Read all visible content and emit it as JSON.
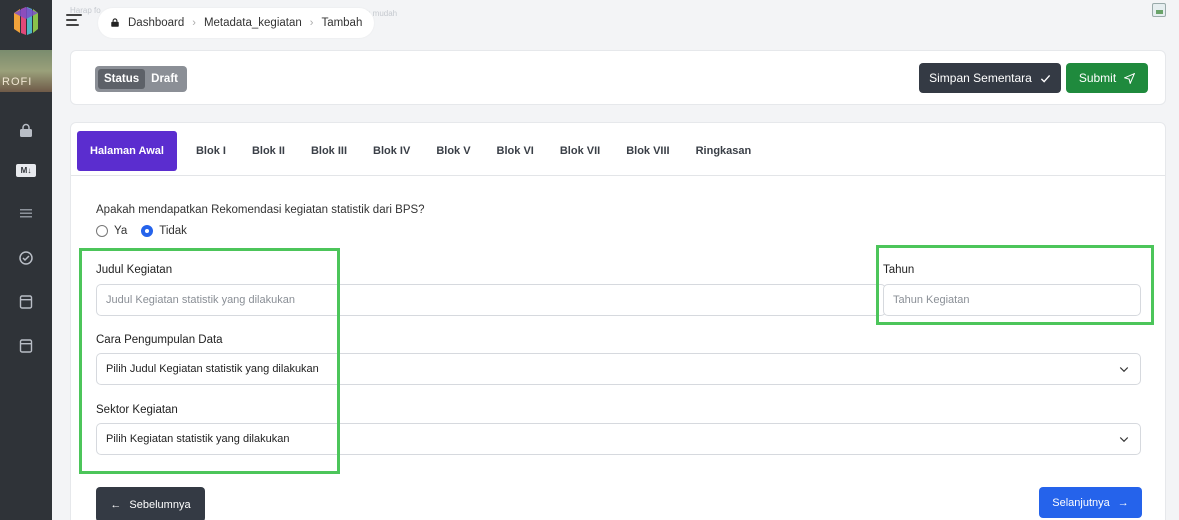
{
  "sidebar": {
    "brand_caption": "ROFI",
    "icons": [
      "bag-icon",
      "markdown-badge-icon",
      "list-icon",
      "check-circle-icon",
      "document-icon",
      "document-icon"
    ],
    "badge_text": "M↓"
  },
  "breadcrumb": {
    "items": [
      "Dashboard",
      "Metadata_kegiatan",
      "Tambah"
    ],
    "faint_left": "Harap fo",
    "faint_right": "h mudah"
  },
  "status": {
    "label": "Status",
    "value": "Draft"
  },
  "actions": {
    "save_label": "Simpan Sementara",
    "submit_label": "Submit"
  },
  "tabs": [
    {
      "label": "Halaman Awal",
      "active": true
    },
    {
      "label": "Blok I"
    },
    {
      "label": "Blok II"
    },
    {
      "label": "Blok III"
    },
    {
      "label": "Blok IV"
    },
    {
      "label": "Blok V"
    },
    {
      "label": "Blok VI"
    },
    {
      "label": "Blok VII"
    },
    {
      "label": "Blok VIII"
    },
    {
      "label": "Ringkasan"
    }
  ],
  "form": {
    "question": "Apakah mendapatkan Rekomendasi kegiatan statistik dari BPS?",
    "options": [
      {
        "label": "Ya",
        "checked": false
      },
      {
        "label": "Tidak",
        "checked": true
      }
    ],
    "judul_label": "Judul Kegiatan",
    "judul_placeholder": "Judul Kegiatan statistik yang dilakukan",
    "tahun_label": "Tahun",
    "tahun_placeholder": "Tahun Kegiatan",
    "cara_label": "Cara Pengumpulan Data",
    "cara_value": "Pilih Judul Kegiatan statistik yang dilakukan",
    "sektor_label": "Sektor Kegiatan",
    "sektor_value": "Pilih Kegiatan statistik yang dilakukan"
  },
  "nav": {
    "prev_label": "Sebelumnya",
    "next_label": "Selanjutnya"
  },
  "colors": {
    "sidebar": "#2f3338",
    "active_tab": "#5b2dcf",
    "submit": "#1f8a3d",
    "next": "#2563eb",
    "highlight": "#4cc55a"
  }
}
